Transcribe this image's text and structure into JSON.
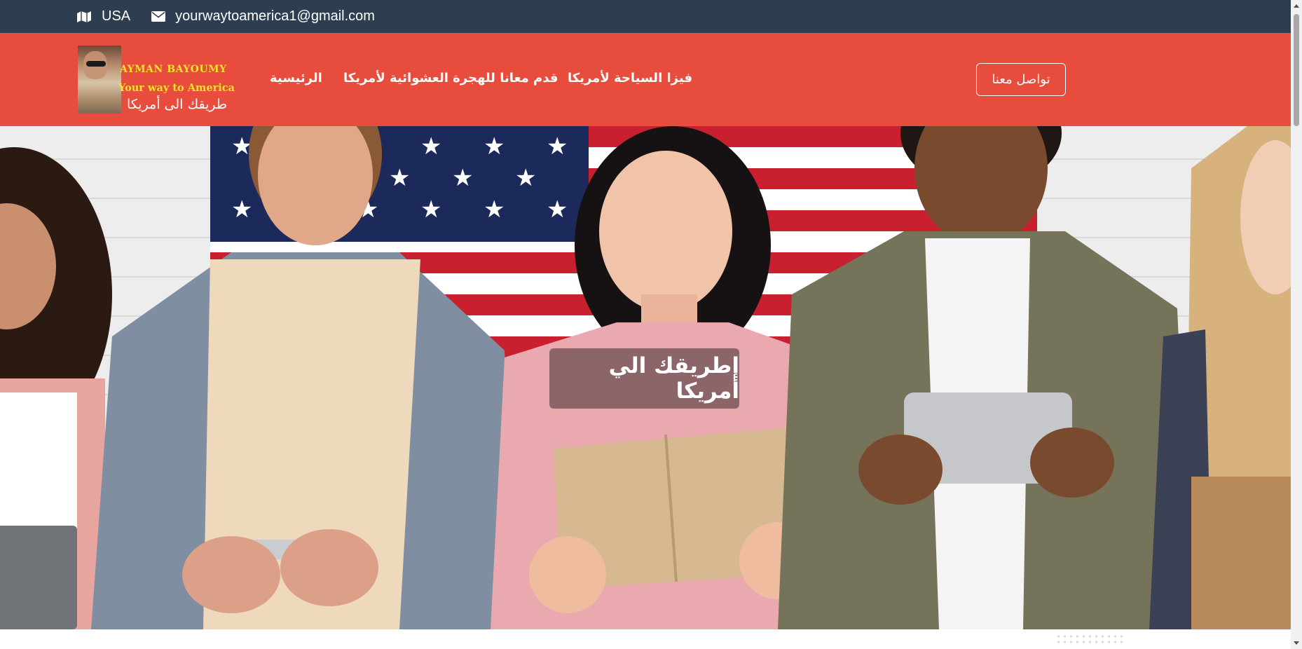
{
  "topbar": {
    "location_icon": "map-icon",
    "location_text": "USA",
    "email_icon": "envelope-icon",
    "email_text": "yourwaytoamerica1@gmail.com"
  },
  "logo": {
    "line1": "AYMAN BAYOUMY",
    "line2": "Your way to America",
    "line3": "طريقك الى أمريكا"
  },
  "nav": {
    "home": "الرئيسية",
    "lottery": "قدم معانا للهجرة العشوائية لأمريكا",
    "visa": "فيزا السياحة لأمريكا",
    "contact": "تواصل معنا"
  },
  "hero": {
    "caption": "إطريقك الي أمريكا"
  },
  "colors": {
    "topbar": "#2c3e50",
    "navbar": "#e74c3c",
    "logo_text": "#f6e12b"
  }
}
